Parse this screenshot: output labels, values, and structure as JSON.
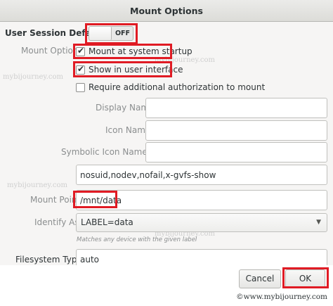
{
  "window": {
    "title": "Mount Options"
  },
  "session": {
    "label": "User Session Defaults",
    "switch_state": "OFF"
  },
  "mount_options": {
    "label": "Mount Options",
    "startup": {
      "label": "Mount at system startup",
      "checked": true
    },
    "show_ui": {
      "label": "Show in user interface",
      "checked": true
    },
    "require_auth": {
      "label": "Require additional authorization to mount",
      "checked": false
    }
  },
  "fields": {
    "display_name": {
      "label": "Display Name",
      "value": ""
    },
    "icon_name": {
      "label": "Icon Name",
      "value": ""
    },
    "symbolic_icon_name": {
      "label": "Symbolic Icon Name",
      "value": ""
    },
    "options": {
      "value": "nosuid,nodev,nofail,x-gvfs-show"
    },
    "mount_point": {
      "label": "Mount Point",
      "value": "/mnt/data"
    },
    "identify_as": {
      "label": "Identify As",
      "value": "LABEL=data",
      "hint": "Matches any device with the given label"
    },
    "filesystem_type": {
      "label": "Filesystem Type",
      "value": "auto"
    }
  },
  "buttons": {
    "cancel": "Cancel",
    "ok": "OK"
  },
  "watermark": {
    "text": "mybijourney.com",
    "copyright": "©www.mybijourney.com"
  },
  "colors": {
    "highlight": "#e01b24",
    "dialog_bg": "#f6f5f4"
  },
  "icons": {
    "checkbox": "check-mark-icon",
    "dropdown": "chevron-down-icon"
  }
}
